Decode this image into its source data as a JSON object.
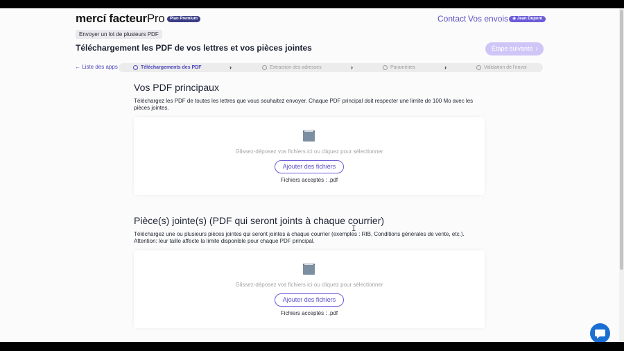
{
  "header": {
    "logo_main": "mercí facteur",
    "logo_pro": "Pro",
    "plan_badge": "Plan Premium",
    "nav": {
      "contact": "Contact",
      "envois": "Vos envois"
    },
    "user": "Jean Dupont"
  },
  "breadcrumb_badge": "Envoyer un lot de plusieurs PDF",
  "page_title": "Téléchargement les PDF de vos lettres et vos pièces jointes",
  "next_step_label": "Étape suivante",
  "back_link": "Liste des apps",
  "steps": [
    {
      "label": "Téléchargements des PDF",
      "active": true
    },
    {
      "label": "Extraction des adresses",
      "active": false
    },
    {
      "label": "Paramètres",
      "active": false
    },
    {
      "label": "Validation de l'envoi",
      "active": false
    }
  ],
  "main_pdfs": {
    "title": "Vos PDF principaux",
    "description": "Téléchargez les PDF de toutes les lettres que vous souhaitez envoyer. Chaque PDF principal doit respecter une limite de 100 Mo avec les pièces jointes.",
    "drop_hint": "Glissez-déposez vos fichiers ici ou cliquez pour sélectionner",
    "button": "Ajouter des fichiers",
    "accepted": "Fichiers acceptés : .pdf"
  },
  "attachments": {
    "title": "Pièce(s) jointe(s) (PDF qui seront joints à chaque courrier)",
    "description": "Téléchargez une ou plusieurs pièces jointes qui seront jointes à chaque courrier (exemples : RIB, Conditions générales de vente, etc.). Attention: leur taille affecte la limite disponible pour chaque PDF principal.",
    "drop_hint": "Glissez-déposez vos fichiers ici ou cliquez pour sélectionner",
    "button": "Ajouter des fichiers",
    "accepted": "Fichiers acceptés : .pdf"
  },
  "icons": {
    "back": "arrow-left-icon",
    "folder": "folder-icon",
    "chat": "chat-icon",
    "user": "user-icon"
  },
  "colors": {
    "accent": "#5a4fc6",
    "badge_dark": "#3a3d86",
    "next_step_bg": "#cfc6f7",
    "chat": "#1b6fd3"
  }
}
